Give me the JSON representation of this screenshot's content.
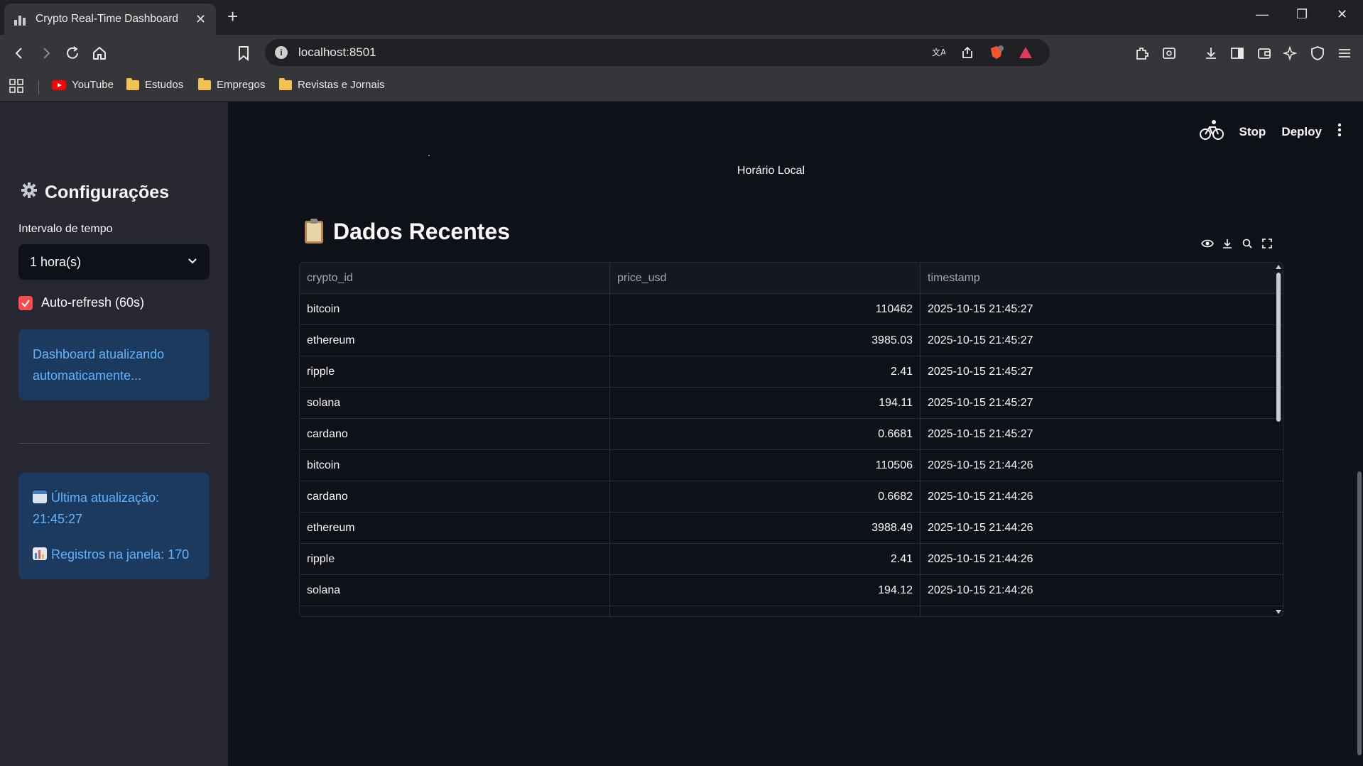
{
  "browser": {
    "tab_title": "Crypto Real-Time Dashboard",
    "url": "localhost:8501",
    "bookmarks": [
      "YouTube",
      "Estudos",
      "Empregos",
      "Revistas e Jornais"
    ]
  },
  "sidebar": {
    "title": "Configurações",
    "interval_label": "Intervalo de tempo",
    "interval_value": "1 hora(s)",
    "autorefresh_label": "Auto-refresh (60s)",
    "autorefresh_checked": true,
    "info_message": "Dashboard atualizando automaticamente...",
    "last_update": "Última atualização: 21:45:27",
    "records": "Registros na janela: 170"
  },
  "header": {
    "stop_label": "Stop",
    "deploy_label": "Deploy"
  },
  "main": {
    "caption": "Horário Local",
    "section_title": "Dados Recentes",
    "table": {
      "columns": [
        "crypto_id",
        "price_usd",
        "timestamp"
      ],
      "rows": [
        [
          "bitcoin",
          "110462",
          "2025-10-15 21:45:27"
        ],
        [
          "ethereum",
          "3985.03",
          "2025-10-15 21:45:27"
        ],
        [
          "ripple",
          "2.41",
          "2025-10-15 21:45:27"
        ],
        [
          "solana",
          "194.11",
          "2025-10-15 21:45:27"
        ],
        [
          "cardano",
          "0.6681",
          "2025-10-15 21:45:27"
        ],
        [
          "bitcoin",
          "110506",
          "2025-10-15 21:44:26"
        ],
        [
          "cardano",
          "0.6682",
          "2025-10-15 21:44:26"
        ],
        [
          "ethereum",
          "3988.49",
          "2025-10-15 21:44:26"
        ],
        [
          "ripple",
          "2.41",
          "2025-10-15 21:44:26"
        ],
        [
          "solana",
          "194.12",
          "2025-10-15 21:44:26"
        ]
      ]
    }
  },
  "colors": {
    "accent": "#ff4b4b",
    "info_bg": "#1c3a5e",
    "info_text": "#60b4ff"
  }
}
